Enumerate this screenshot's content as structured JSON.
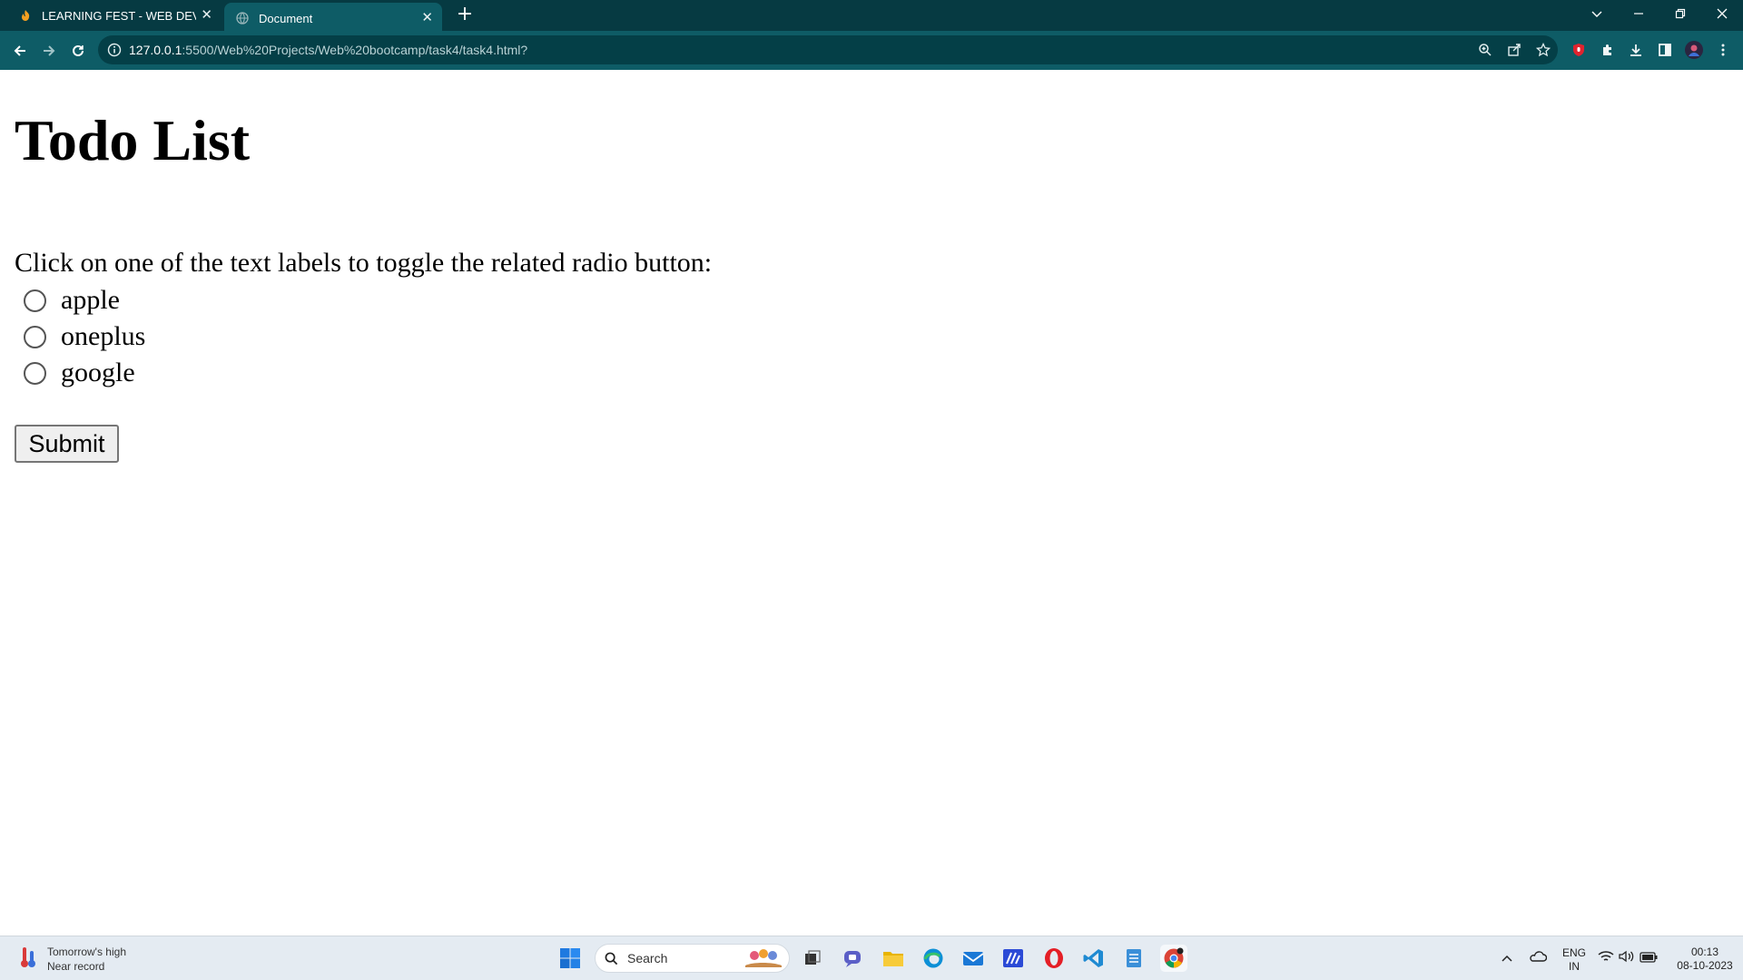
{
  "browser": {
    "tabs": [
      {
        "title": "LEARNING FEST - WEB DEVELOP",
        "favicon": "flame-icon",
        "active": false
      },
      {
        "title": "Document",
        "favicon": "globe-icon",
        "active": true
      }
    ],
    "url_host": "127.0.0.1",
    "url_rest": ":5500/Web%20Projects/Web%20bootcamp/task4/task4.html?",
    "accent": "#0e5c66",
    "tabstrip_color": "#063a42"
  },
  "page": {
    "title": "Todo List",
    "instruction": "Click on one of the text labels to toggle the related radio button:",
    "options": [
      {
        "label": "apple",
        "checked": false
      },
      {
        "label": "oneplus",
        "checked": false
      },
      {
        "label": "google",
        "checked": false
      }
    ],
    "submit_label": "Submit"
  },
  "taskbar": {
    "weather_line1": "Tomorrow's high",
    "weather_line2": "Near record",
    "search_placeholder": "Search",
    "language_line1": "ENG",
    "language_line2": "IN",
    "time": "00:13",
    "date": "08-10-2023"
  }
}
